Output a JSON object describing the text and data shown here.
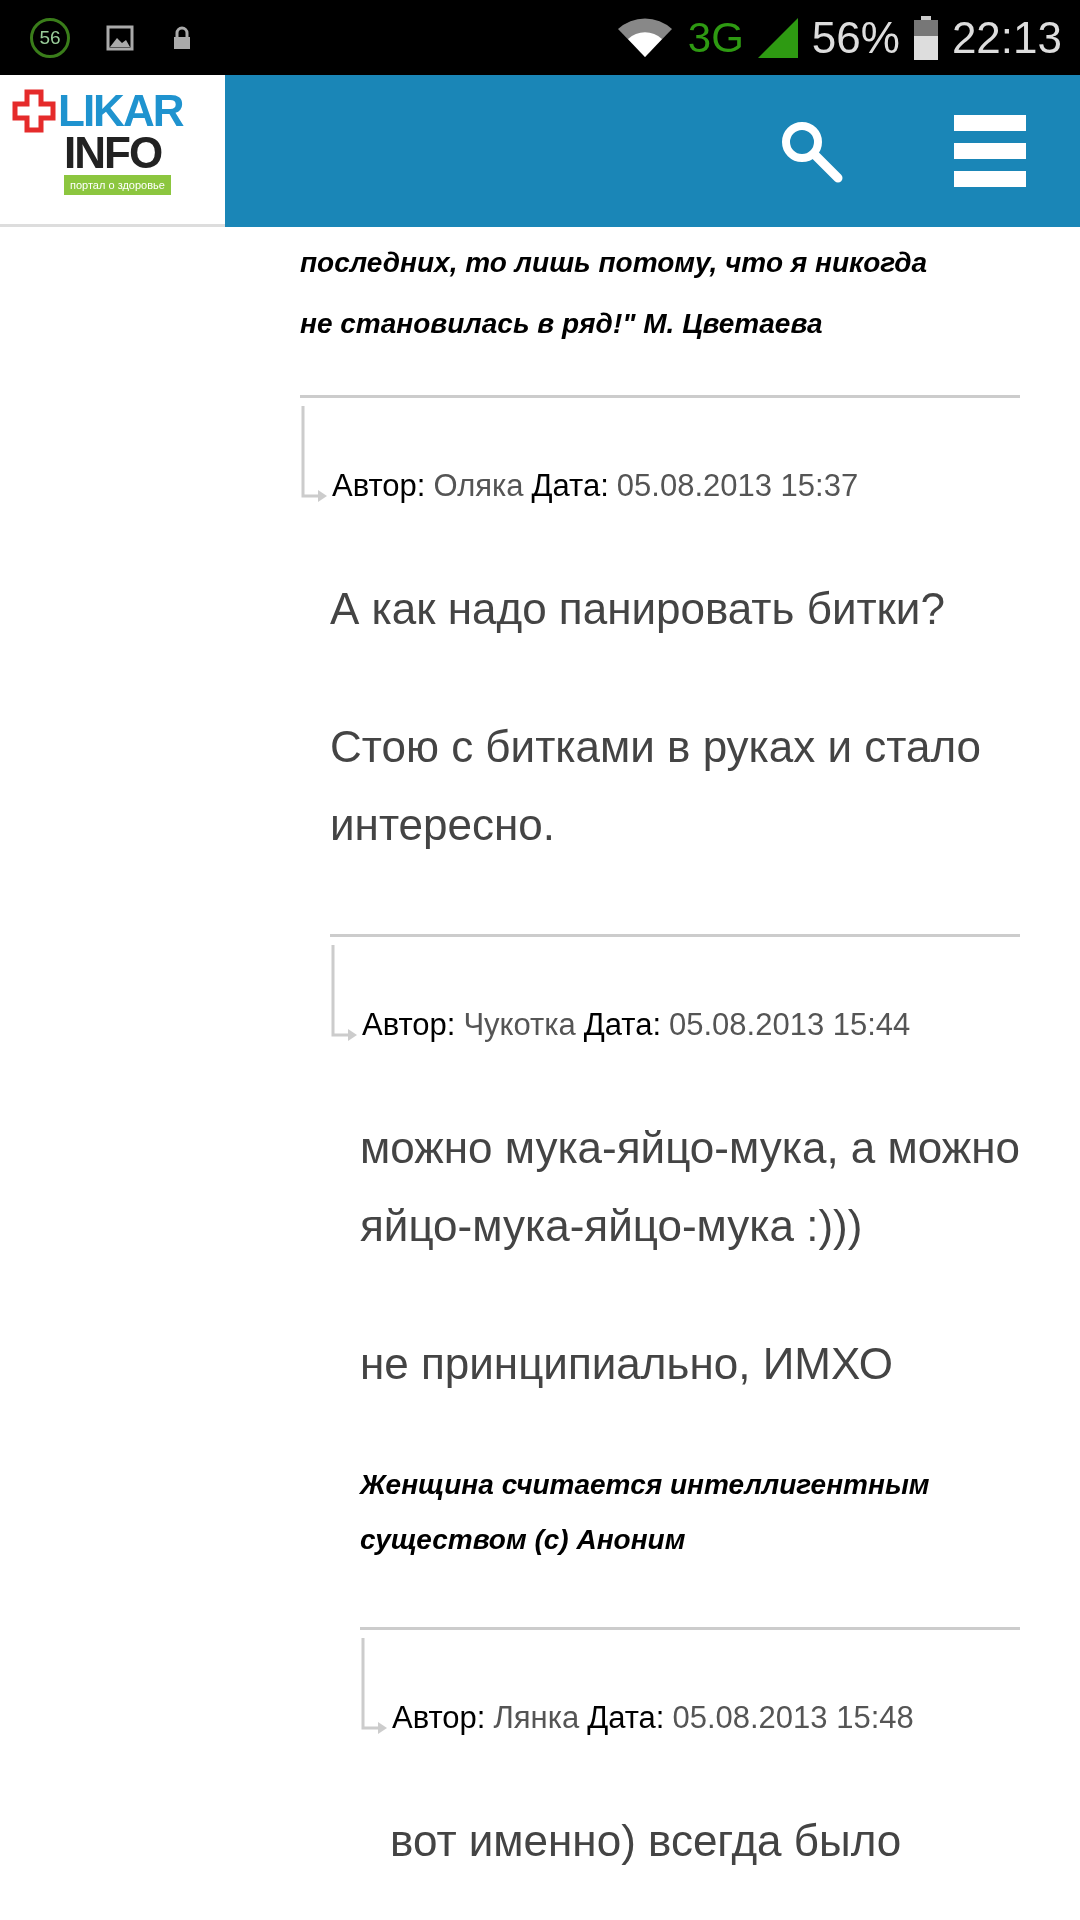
{
  "status_bar": {
    "badge": "56",
    "network": "3G",
    "battery": "56%",
    "time": "22:13"
  },
  "header": {
    "logo_title": "LIKAR",
    "logo_subtitle": "INFO",
    "logo_tagline": "портал о здоровье"
  },
  "thread": {
    "signature": [
      "последних, то лишь потому, что я никогда",
      "не становилась в ряд!\" М. Цветаева"
    ],
    "children": [
      {
        "author_label": "Автор:",
        "author": "Оляка",
        "date_label": "Дата:",
        "date": "05.08.2013 15:37",
        "paragraphs": [
          "А как надо панировать битки?",
          "Стою с битками в руках и стало интересно."
        ],
        "children": [
          {
            "author_label": "Автор:",
            "author": "Чукотка",
            "date_label": "Дата:",
            "date": "05.08.2013 15:44",
            "paragraphs": [
              "можно мука-яйцо-мука, а можно яйцо-мука-яйцо-мука :)))",
              "не принципиально, ИМХО"
            ],
            "signature": [
              "Женщина считается интеллигентным существом (с) Аноним"
            ],
            "children": [
              {
                "author_label": "Автор:",
                "author": "Лянка",
                "date_label": "Дата:",
                "date": "05.08.2013 15:48",
                "paragraphs": [
                  "вот именно) всегда было"
                ]
              }
            ]
          }
        ]
      }
    ]
  }
}
